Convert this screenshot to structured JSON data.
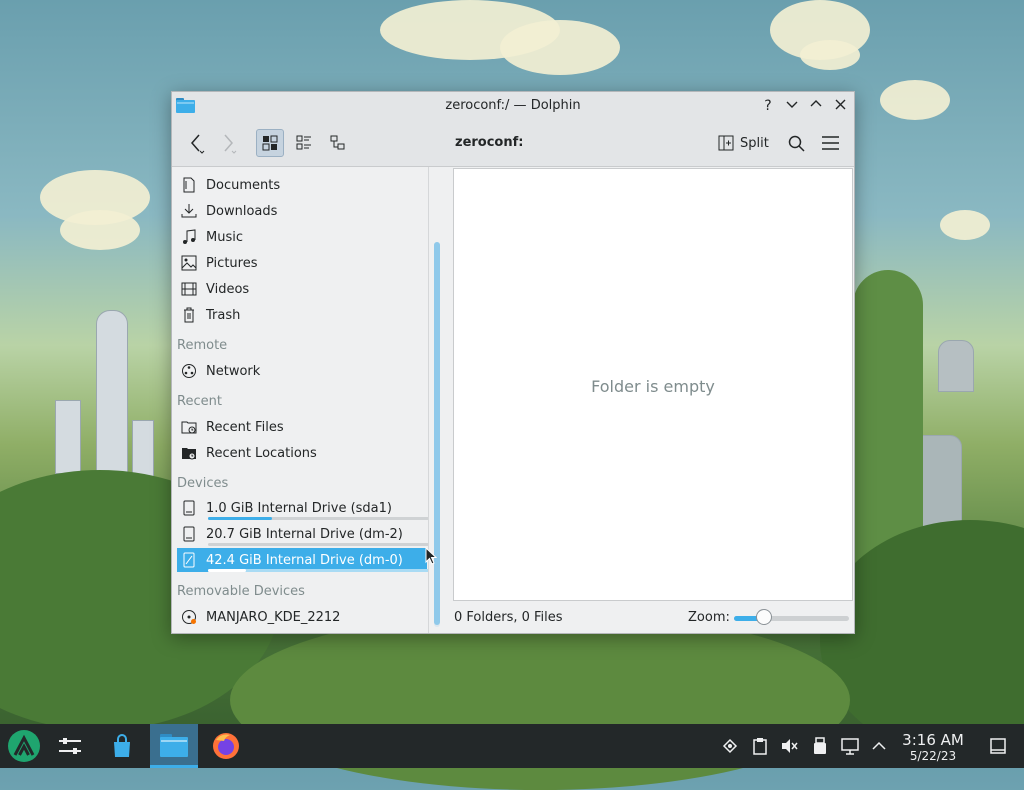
{
  "window": {
    "title": "zeroconf:/ — Dolphin",
    "buttons": {
      "help": "?",
      "minimize": "⌄",
      "maximize": "⌃",
      "close": "✕"
    }
  },
  "toolbar": {
    "location": "zeroconf:",
    "split_label": "Split"
  },
  "places": {
    "items": [
      {
        "label": "Documents",
        "icon": "documents-icon"
      },
      {
        "label": "Downloads",
        "icon": "downloads-icon"
      },
      {
        "label": "Music",
        "icon": "music-icon"
      },
      {
        "label": "Pictures",
        "icon": "pictures-icon"
      },
      {
        "label": "Videos",
        "icon": "videos-icon"
      },
      {
        "label": "Trash",
        "icon": "trash-icon"
      }
    ],
    "remote_heading": "Remote",
    "remote": [
      {
        "label": "Network",
        "icon": "network-icon"
      }
    ],
    "recent_heading": "Recent",
    "recent": [
      {
        "label": "Recent Files",
        "icon": "recent-files-icon"
      },
      {
        "label": "Recent Locations",
        "icon": "recent-locations-icon"
      }
    ],
    "devices_heading": "Devices",
    "devices": [
      {
        "label": "1.0 GiB Internal Drive (sda1)",
        "usage": 0.29
      },
      {
        "label": "20.7 GiB Internal Drive (dm-2)",
        "usage": 0.0
      },
      {
        "label": "42.4 GiB Internal Drive (dm-0)",
        "usage": 0.17,
        "selected": true
      }
    ],
    "removable_heading": "Removable Devices",
    "removable": [
      {
        "label": "MANJARO_KDE_2212",
        "icon": "optical-disc-icon"
      }
    ]
  },
  "view": {
    "empty_message": "Folder is empty",
    "status": "0 Folders, 0 Files",
    "zoom_label": "Zoom:",
    "zoom_level": 0.26
  },
  "taskbar": {
    "time": "3:16 AM",
    "date": "5/22/23"
  },
  "colors": {
    "accent": "#3daee9",
    "taskbar": "#232829",
    "window_bg": "#eff0f1"
  }
}
